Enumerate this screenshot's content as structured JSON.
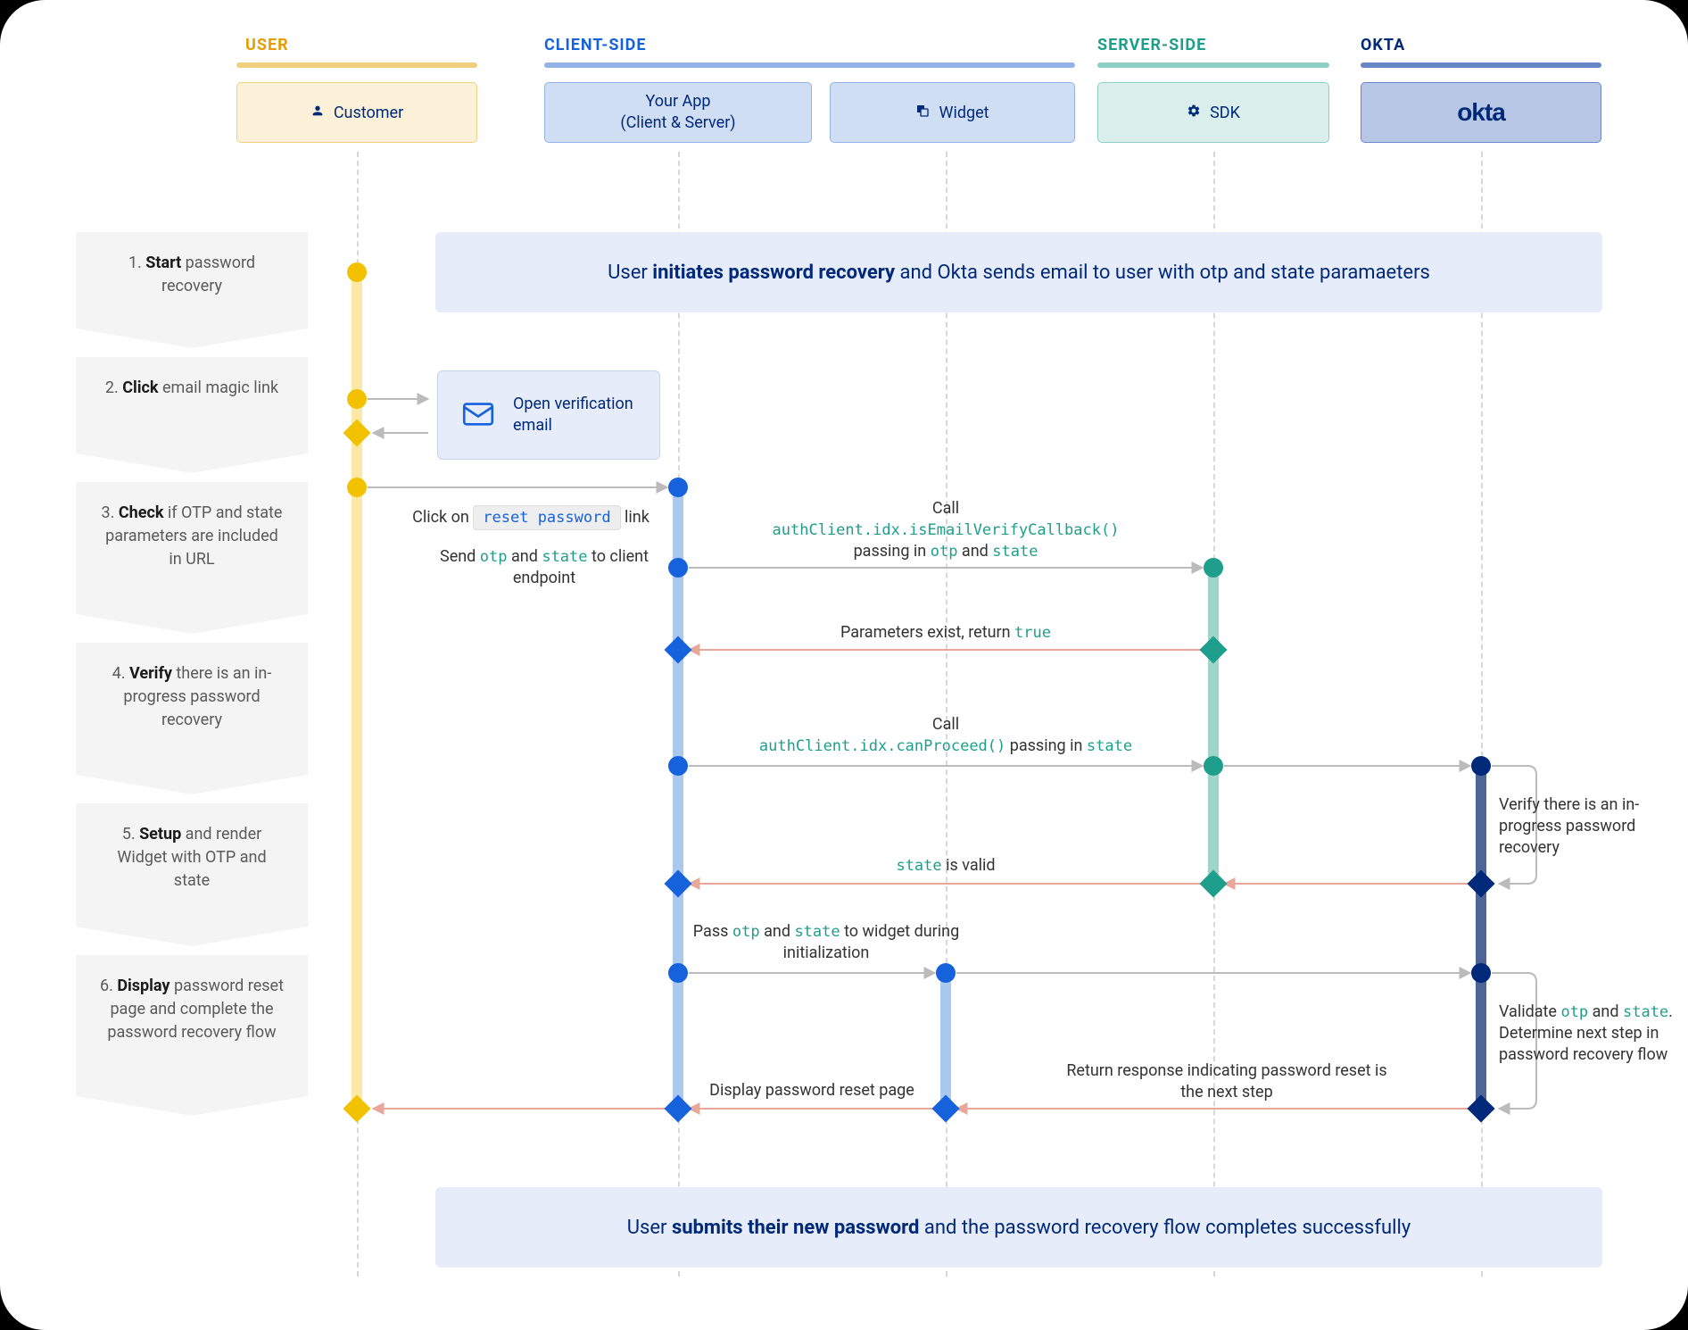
{
  "columns": {
    "user": {
      "label": "USER",
      "box": "Customer"
    },
    "client": {
      "label": "CLIENT-SIDE",
      "app_line1": "Your App",
      "app_line2": "(Client & Server)",
      "widget": "Widget"
    },
    "server": {
      "label": "SERVER-SIDE",
      "sdk": "SDK"
    },
    "okta": {
      "label": "OKTA",
      "logo": "okta"
    }
  },
  "steps": [
    {
      "n": "1.",
      "bold": "Start",
      "rest": " password recovery"
    },
    {
      "n": "2.",
      "bold": "Click",
      "rest": " email magic link"
    },
    {
      "n": "3.",
      "bold": "Check",
      "rest": " if OTP and state parameters are included in URL"
    },
    {
      "n": "4.",
      "bold": "Verify",
      "rest": " there is an in-progress password recovery"
    },
    {
      "n": "5.",
      "bold": "Setup",
      "rest": " and render Widget with OTP and state"
    },
    {
      "n": "6.",
      "bold": "Display",
      "rest": " password reset page and complete the password recovery flow"
    }
  ],
  "banner_top": {
    "pre": "User ",
    "bold": "initiates password recovery",
    "post": " and Okta sends email to user with otp and state paramaeters"
  },
  "banner_bottom": {
    "pre": "User ",
    "bold": "submits their new password",
    "post": " and the password recovery flow completes successfully"
  },
  "email_card": "Open verification email",
  "labels": {
    "click_on": "Click on ",
    "reset_password": "reset password",
    "link_suffix": " link",
    "send_otp": "Send ",
    "otp": "otp",
    "and": " and ",
    "state": "state",
    "to_client": " to client endpoint",
    "call": "Call",
    "cb": "authClient.idx.isEmailVerifyCallback()",
    "passing_in": "passing in ",
    "params_exist": "Parameters exist, return ",
    "true": "true",
    "canProceed": "authClient.idx.canProceed()",
    "passing_in_state": " passing in ",
    "verify_inprogress": "Verify there is an in-progress password recovery",
    "state_valid_pre": "",
    "state_valid": " is valid",
    "pass_otp": "Pass ",
    "to_widget": " to widget during initialization",
    "display_reset": "Display password reset page",
    "return_response": "Return response indicating password reset is the next step",
    "validate": "Validate ",
    "determine": ". Determine next step in password recovery flow"
  }
}
